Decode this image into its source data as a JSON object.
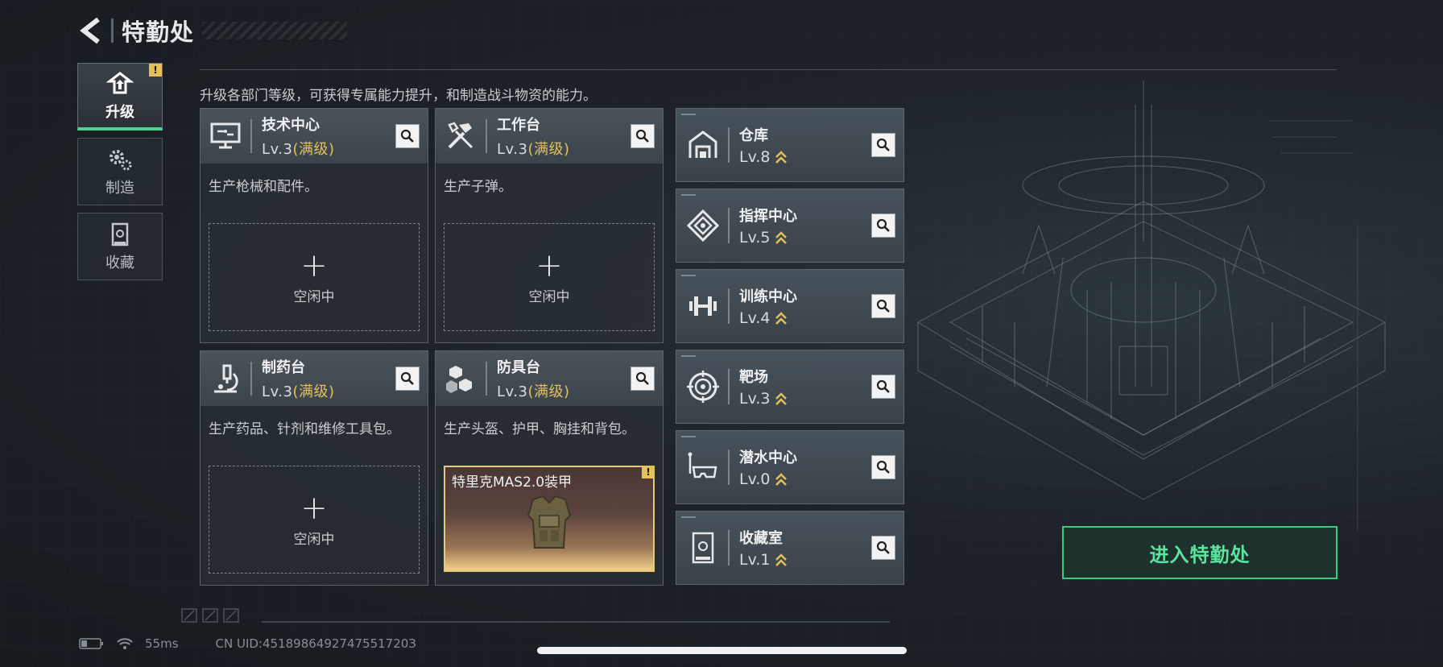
{
  "header": {
    "title": "特勤处"
  },
  "side_tabs": [
    {
      "label": "升级",
      "icon": "upgrade-icon",
      "active": true,
      "warn": "!"
    },
    {
      "label": "制造",
      "icon": "gears-icon",
      "active": false
    },
    {
      "label": "收藏",
      "icon": "collection-icon",
      "active": false
    }
  ],
  "description": "升级各部门等级，可获得专属能力提升，和制造战斗物资的能力。",
  "cards": [
    {
      "name": "技术中心",
      "level": "Lv.3",
      "max": "(满级)",
      "desc": "生产枪械和配件。",
      "slot_plus": "+",
      "slot_idle": "空闲中",
      "icon": "computer-icon"
    },
    {
      "name": "工作台",
      "level": "Lv.3",
      "max": "(满级)",
      "desc": "生产子弹。",
      "slot_plus": "+",
      "slot_idle": "空闲中",
      "icon": "tools-icon"
    },
    {
      "name": "制药台",
      "level": "Lv.3",
      "max": "(满级)",
      "desc": "生产药品、针剂和维修工具包。",
      "slot_plus": "+",
      "slot_idle": "空闲中",
      "icon": "microscope-icon"
    },
    {
      "name": "防具台",
      "level": "Lv.3",
      "max": "(满级)",
      "desc": "生产头盔、护甲、胸挂和背包。",
      "slot_item": "特里克MAS2.0装甲",
      "slot_warn": "!",
      "icon": "cubes-icon"
    }
  ],
  "facilities": [
    {
      "name": "仓库",
      "level": "Lv.8",
      "icon": "warehouse-icon"
    },
    {
      "name": "指挥中心",
      "level": "Lv.5",
      "icon": "command-icon"
    },
    {
      "name": "训练中心",
      "level": "Lv.4",
      "icon": "dumbbell-icon"
    },
    {
      "name": "靶场",
      "level": "Lv.3",
      "icon": "target-icon"
    },
    {
      "name": "潜水中心",
      "level": "Lv.0",
      "icon": "diving-mask-icon"
    },
    {
      "name": "收藏室",
      "level": "Lv.1",
      "icon": "collection-room-icon"
    }
  ],
  "enter_button": "进入特勤处",
  "status_bar": {
    "ping": "55ms",
    "uid": "CN UID:4518986492747551720З"
  },
  "colors": {
    "accent_green": "#3ec983",
    "max_gold": "#e3c05a",
    "warn_yellow": "#e6c15a"
  }
}
